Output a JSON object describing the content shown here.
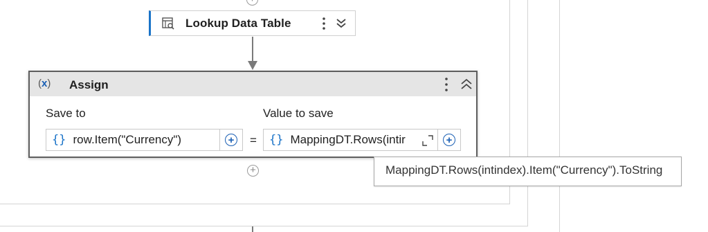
{
  "lookup_activity": {
    "title": "Lookup Data Table",
    "icon": "table-lookup-icon"
  },
  "assign_activity": {
    "title": "Assign",
    "icon": "variable-x-icon",
    "save_to_label": "Save to",
    "save_to_value": "row.Item(\"Currency\")",
    "equals": "=",
    "value_label": "Value to save",
    "value_text": "MappingDT.Rows(intir",
    "brace_glyph": "{}"
  },
  "tooltip": {
    "text": "MappingDT.Rows(intindex).Item(\"Currency\").ToString"
  },
  "colors": {
    "accent": "#1a73c8",
    "header_bg": "#e5e5e5",
    "border_selected": "#5e5e5e"
  }
}
